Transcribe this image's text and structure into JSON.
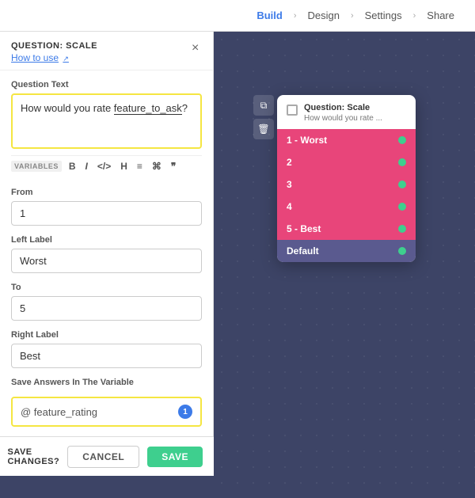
{
  "nav": {
    "build_label": "Build",
    "design_label": "Design",
    "settings_label": "Settings",
    "share_label": "Share"
  },
  "panel": {
    "title": "QUESTION: SCALE",
    "subtitle": "How to use",
    "close_icon": "×",
    "question_text_label": "Question text",
    "question_text_before": "How would you rate ",
    "question_text_var": "feature_to_ask",
    "question_text_after": "?",
    "toolbar_tag": "VARIABLES",
    "toolbar_bold": "B",
    "toolbar_italic": "I",
    "toolbar_code": "</>",
    "toolbar_heading": "H",
    "toolbar_list": "≡",
    "toolbar_link": "⌘",
    "toolbar_quote": "❞",
    "from_label": "From",
    "from_value": "1",
    "left_label_label": "Left Label",
    "left_label_value": "Worst",
    "to_label": "To",
    "to_value": "5",
    "right_label_label": "Right Label",
    "right_label_value": "Best",
    "save_answers_label": "Save answers in the variable",
    "save_answers_value": "@ feature_rating",
    "save_answers_badge": "1"
  },
  "bottom_bar": {
    "save_changes_label": "SAVE CHANGES?",
    "cancel_label": "CANCEL",
    "save_label": "SAVE"
  },
  "card": {
    "title": "Question: Scale",
    "subtitle": "How would you rate ...",
    "options": [
      {
        "label": "1 - Worst",
        "type": "pink"
      },
      {
        "label": "2",
        "type": "pink"
      },
      {
        "label": "3",
        "type": "pink"
      },
      {
        "label": "4",
        "type": "pink"
      },
      {
        "label": "5 - Best",
        "type": "pink"
      },
      {
        "label": "Default",
        "type": "purple"
      }
    ]
  }
}
